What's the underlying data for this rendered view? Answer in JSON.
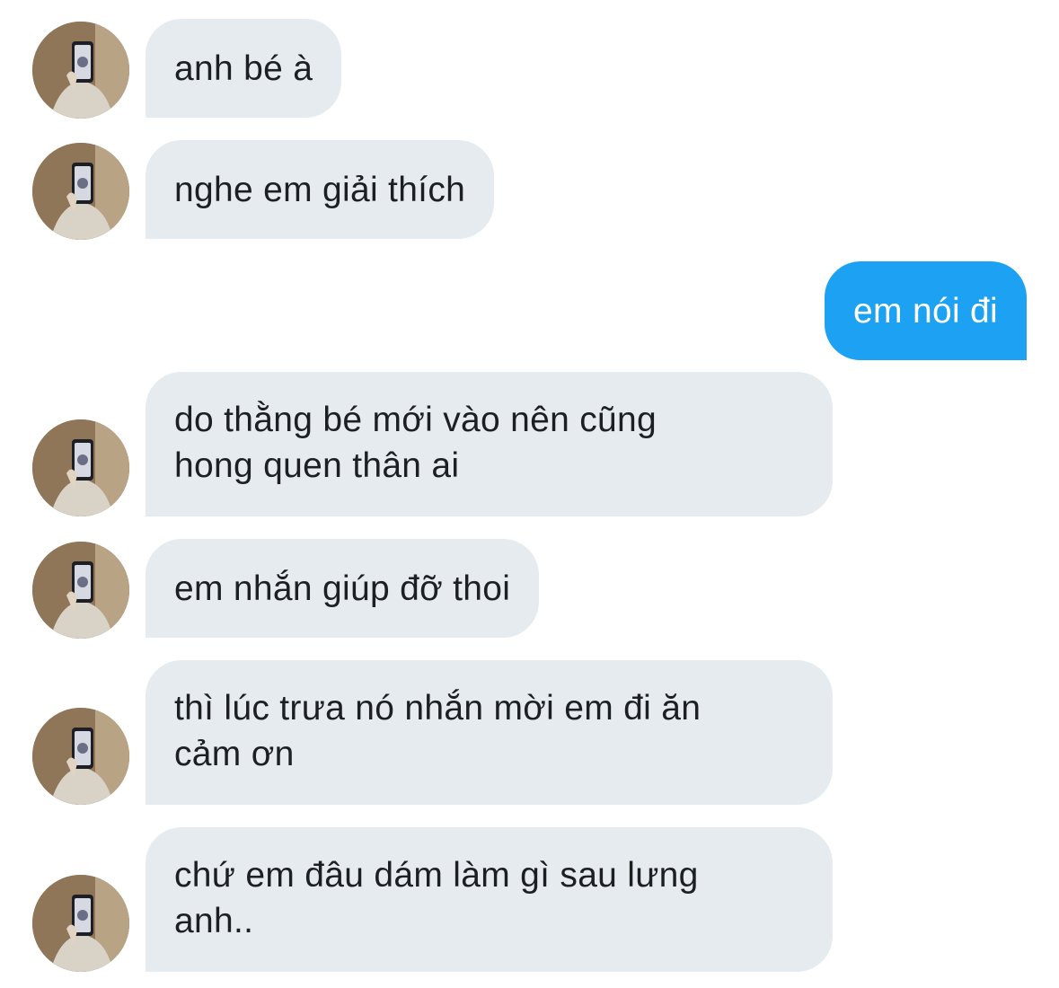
{
  "conversation": {
    "messages": [
      {
        "sender": "them",
        "lines": [
          "anh bé à"
        ]
      },
      {
        "sender": "them",
        "lines": [
          "nghe em giải thích"
        ]
      },
      {
        "sender": "me",
        "lines": [
          "em nói đi"
        ]
      },
      {
        "sender": "them",
        "lines": [
          "do thằng bé mới vào nên cũng",
          "hong quen thân ai"
        ]
      },
      {
        "sender": "them",
        "lines": [
          "em nhắn giúp đỡ thoi"
        ]
      },
      {
        "sender": "them",
        "lines": [
          "thì lúc trưa nó nhắn mời em đi ăn",
          "cảm ơn"
        ]
      },
      {
        "sender": "them",
        "lines": [
          "chứ em đâu dám làm gì sau lưng",
          "anh.."
        ]
      }
    ]
  },
  "colors": {
    "incoming_bubble": "#e6ebef",
    "incoming_text": "#1c2023",
    "outgoing_bubble": "#1da1f2",
    "outgoing_text": "#ffffff"
  },
  "icons": {
    "avatar": "user-avatar-photo"
  }
}
